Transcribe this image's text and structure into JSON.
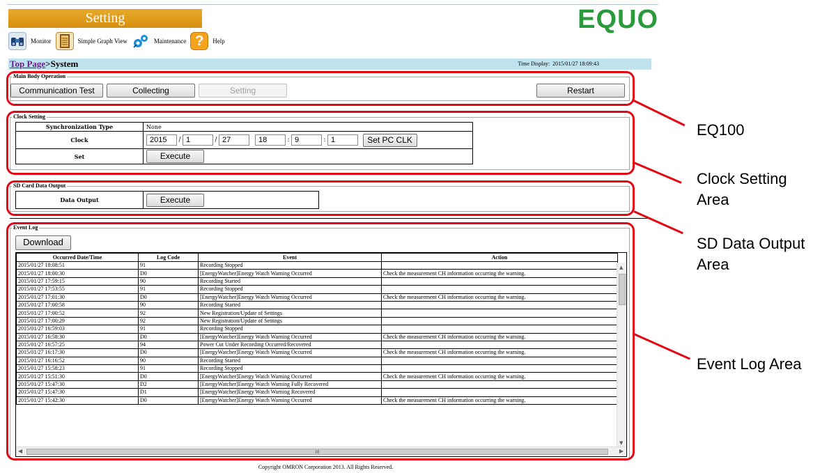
{
  "header": {
    "title": "Setting",
    "logo": "EQUO"
  },
  "nav": [
    {
      "label": "Monitor",
      "icon": "binoculars-icon",
      "color": "#3a6fb0"
    },
    {
      "label": "Simple Graph View",
      "icon": "ledger-icon",
      "color": "#7a4a12"
    },
    {
      "label": "Maintenance",
      "icon": "gears-icon",
      "color": "#1e8fd6"
    },
    {
      "label": "Help",
      "icon": "question-icon",
      "color": "#f4a31c"
    }
  ],
  "breadcrumb": {
    "link": "Top Page",
    "separator": ">",
    "current": "System",
    "time_label": "Time Display:",
    "time_value": "2015/01/27 18:09:43"
  },
  "main_body": {
    "legend": "Main Body Operation",
    "buttons": {
      "communication_test": "Communication Test",
      "collecting": "Collecting",
      "setting": "Setting",
      "restart": "Restart"
    }
  },
  "clock": {
    "legend": "Clock Setting",
    "sync_label": "Synchronization Type",
    "sync_value": "None",
    "clock_label": "Clock",
    "year": "2015",
    "month": "1",
    "day": "27",
    "hour": "18",
    "minute": "9",
    "second": "1",
    "sep_date": "/",
    "sep_time": ":",
    "set_pc_clk": "Set PC CLK",
    "set_label": "Set",
    "execute": "Execute"
  },
  "sd": {
    "legend": "SD Card Data Output",
    "label": "Data Output",
    "execute": "Execute"
  },
  "event_log": {
    "legend": "Event Log",
    "download": "Download",
    "columns": [
      "Occurred Date/Time",
      "Log Code",
      "Event",
      "Action"
    ],
    "rows": [
      [
        "2015/01/27 18:08:51",
        "91",
        "Recording Stopped",
        ""
      ],
      [
        "2015/01/27 18:00:30",
        "D0",
        "[EnergyWatcher]Energy Watch Warning Occurred",
        "Check the measurement CH information occurring the warning."
      ],
      [
        "2015/01/27 17:59:15",
        "90",
        "Recording Started",
        ""
      ],
      [
        "2015/01/27 17:53:55",
        "91",
        "Recording Stopped",
        ""
      ],
      [
        "2015/01/27 17:01:30",
        "D0",
        "[EnergyWatcher]Energy Watch Warning Occurred",
        "Check the measurement CH information occurring the warning."
      ],
      [
        "2015/01/27 17:00:58",
        "90",
        "Recording Started",
        ""
      ],
      [
        "2015/01/27 17:00:52",
        "92",
        "New Registration/Update of Settings",
        ""
      ],
      [
        "2015/01/27 17:00:29",
        "92",
        "New Registration/Update of Settings",
        ""
      ],
      [
        "2015/01/27 16:59:03",
        "91",
        "Recording Stopped",
        ""
      ],
      [
        "2015/01/27 16:58:30",
        "D0",
        "[EnergyWatcher]Energy Watch Warning Occurred",
        "Check the measurement CH information occurring the warning."
      ],
      [
        "2015/01/27 16:57:25",
        "94",
        "Power Cut Under Recording Occurred/Recovered",
        ""
      ],
      [
        "2015/01/27 16:17:30",
        "D0",
        "[EnergyWatcher]Energy Watch Warning Occurred",
        "Check the measurement CH information occurring the warning."
      ],
      [
        "2015/01/27 16:16:52",
        "90",
        "Recording Started",
        ""
      ],
      [
        "2015/01/27 15:58:23",
        "91",
        "Recording Stopped",
        ""
      ],
      [
        "2015/01/27 15:51:30",
        "D0",
        "[EnergyWatcher]Energy Watch Warning Occurred",
        "Check the measurement CH information occurring the warning."
      ],
      [
        "2015/01/27 15:47:30",
        "D2",
        "[EnergyWatcher]Energy Watch Warning Fully Recovered",
        ""
      ],
      [
        "2015/01/27 15:47:30",
        "D1",
        "[EnergyWatcher]Energy Watch Warning Recovered",
        ""
      ],
      [
        "2015/01/27 15:42:30",
        "D0",
        "[EnergyWatcher]Energy Watch Warning Occurred",
        "Check the measurement CH information occurring the warning."
      ]
    ],
    "hscroll_mark": "III"
  },
  "callouts": {
    "eq100": "EQ100",
    "clock_area_1": "Clock Setting",
    "clock_area_2": "Area",
    "sd_area_1": "SD Data Output",
    "sd_area_2": "Area",
    "event_area": "Event Log Area"
  },
  "footer": {
    "copyright": "Copyright OMRON Corporation 2013. All Rights Reserved."
  },
  "colors": {
    "title_bar": "#e0a020",
    "logo": "#2c9a3c",
    "breadcrumb_bar": "#bfe3ee",
    "annotation": "#e30613"
  }
}
